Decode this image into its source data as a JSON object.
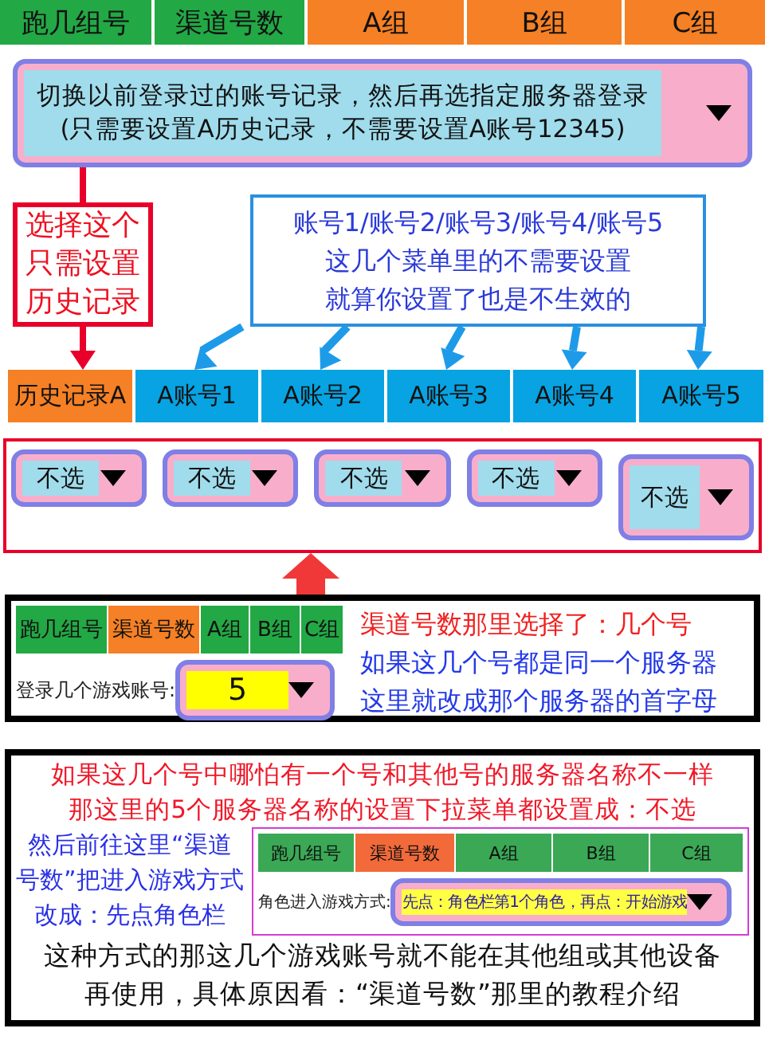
{
  "top_tabs": [
    {
      "label": "跑几组号",
      "color": "#22a845"
    },
    {
      "label": "渠道号数",
      "color": "#22a845"
    },
    {
      "label": "A组",
      "color": "#f58025"
    },
    {
      "label": "B组",
      "color": "#f58025"
    },
    {
      "label": "C组",
      "color": "#f58025"
    }
  ],
  "history_dropdown": {
    "lines": [
      "切换以前登录过的账号记录，然后再选指定服务器登录",
      "(只需要设置A历史记录，不需要设置A账号12345)"
    ]
  },
  "red_callout": [
    "选择这个",
    "只需设置",
    "历史记录"
  ],
  "blue_callout": [
    "账号1/账号2/账号3/账号4/账号5",
    "这几个菜单里的不需要设置",
    "就算你设置了也是不生效的"
  ],
  "account_tabs": [
    {
      "label": "历史记录A",
      "selected": true
    },
    {
      "label": "A账号1",
      "selected": false
    },
    {
      "label": "A账号2",
      "selected": false
    },
    {
      "label": "A账号3",
      "selected": false
    },
    {
      "label": "A账号4",
      "selected": false
    },
    {
      "label": "A账号5",
      "selected": false
    }
  ],
  "server_dropdowns": [
    {
      "value": "不选"
    },
    {
      "value": "不选"
    },
    {
      "value": "不选"
    },
    {
      "value": "不选"
    },
    {
      "value": "不选"
    }
  ],
  "example_1": {
    "tabs": [
      {
        "label": "跑几组号",
        "selected": false
      },
      {
        "label": "渠道号数",
        "selected": true
      },
      {
        "label": "A组",
        "selected": false
      },
      {
        "label": "B组",
        "selected": false
      },
      {
        "label": "C组",
        "selected": false
      }
    ],
    "field_label": "登录几个游戏账号:",
    "field_value": "5",
    "notes": [
      {
        "text": "渠道号数那里选择了：几个号",
        "color": "#f02020"
      },
      {
        "text": "如果这几个号都是同一个服务器",
        "color": "#2238e8"
      },
      {
        "text": "这里就改成那个服务器的首字母",
        "color": "#2238e8"
      }
    ]
  },
  "example_2": {
    "warning": [
      "如果这几个号中哪怕有一个号和其他号的服务器名称不一样",
      "那这里的5个服务器名称的设置下拉菜单都设置成：不选"
    ],
    "instructions": [
      "然后前往这里“渠道",
      "号数”把进入游戏方式",
      "改成：先点角色栏"
    ],
    "tabs": [
      {
        "label": "跑几组号",
        "selected": false
      },
      {
        "label": "渠道号数",
        "selected": true
      },
      {
        "label": "A组",
        "selected": false
      },
      {
        "label": "B组",
        "selected": false
      },
      {
        "label": "C组",
        "selected": false
      }
    ],
    "field_label": "角色进入游戏方式:",
    "field_value": "先点：角色栏第1个角色，再点：开始游戏",
    "footer": [
      "这种方式的那这几个游戏账号就不能在其他组或其他设备",
      "再使用，具体原因看：“渠道号数”那里的教程介绍"
    ]
  }
}
